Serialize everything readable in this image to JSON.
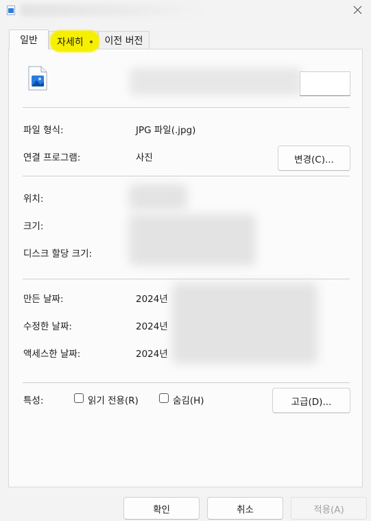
{
  "tabs": [
    {
      "label": "일반"
    },
    {
      "label": "자세히"
    },
    {
      "label": "이전 버전"
    }
  ],
  "file": {
    "type_label": "파일 형식:",
    "type_value": "JPG 파일(.jpg)",
    "open_with_label": "연결 프로그램:",
    "open_with_value": "사진",
    "change_button": "변경(C)..."
  },
  "location": {
    "location_label": "위치:",
    "size_label": "크기:",
    "size_on_disk_label": "디스크 할당 크기:"
  },
  "dates": {
    "created_label": "만든 날짜:",
    "created_value": "2024년",
    "modified_label": "수정한 날짜:",
    "modified_value": "2024년",
    "accessed_label": "액세스한 날짜:",
    "accessed_value": "2024년"
  },
  "attributes": {
    "label": "특성:",
    "readonly_label": "읽기 전용(R)",
    "hidden_label": "숨김(H)",
    "advanced_button": "고급(D)..."
  },
  "footer": {
    "ok": "확인",
    "cancel": "취소",
    "apply": "적용(A)"
  },
  "colors": {
    "highlight": "#f6ef00",
    "icon_blue": "#2b7de0"
  }
}
